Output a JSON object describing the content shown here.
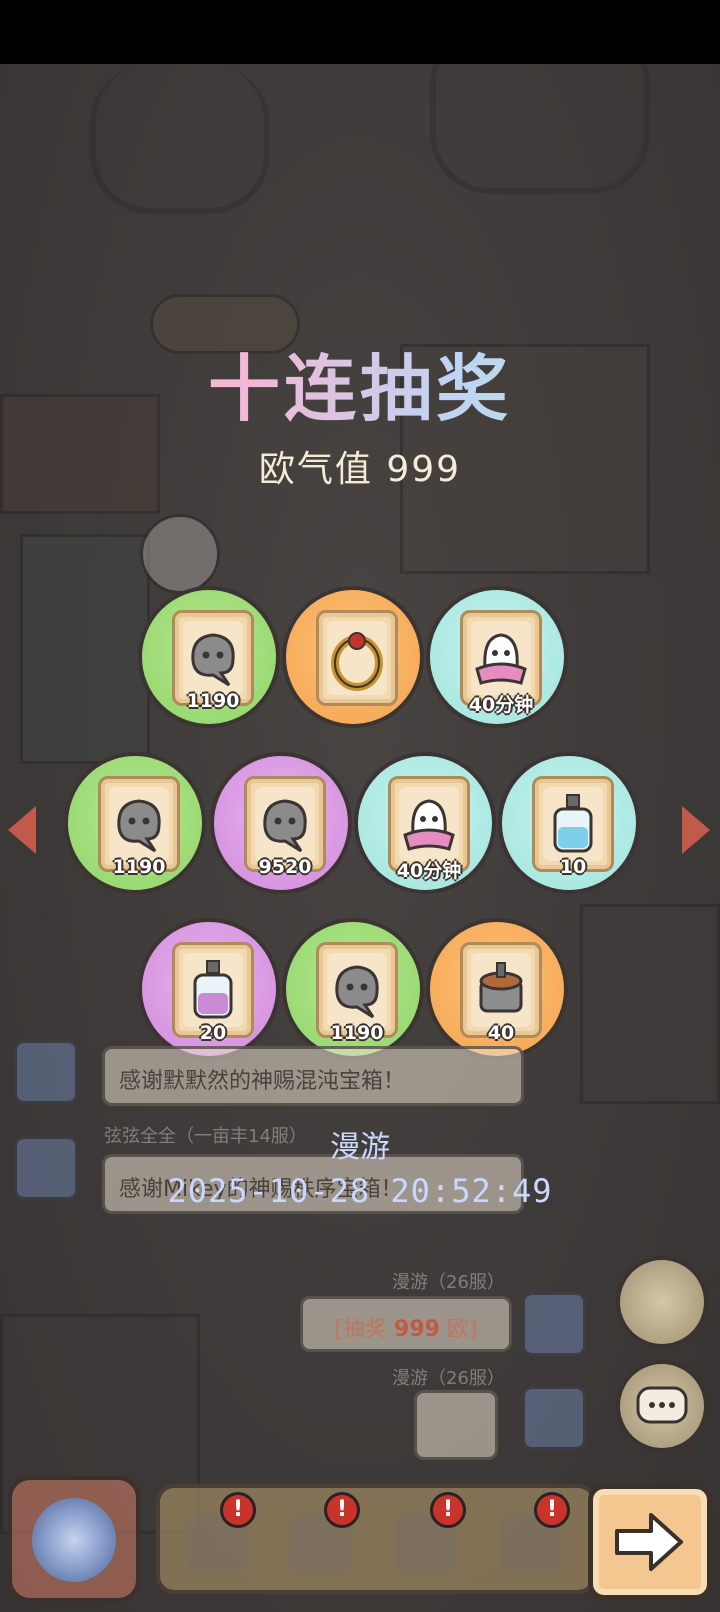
{
  "title": "十连抽奖",
  "luck_label": "欧气值 999",
  "rewards": [
    {
      "amount": "1190",
      "item": "ghost-spirit-icon",
      "color": "green"
    },
    {
      "amount": "",
      "item": "ring-icon",
      "color": "orange"
    },
    {
      "amount": "40分钟",
      "item": "ghost-blanket-icon",
      "color": "cyan"
    },
    {
      "amount": "1190",
      "item": "ghost-spirit-icon",
      "color": "green"
    },
    {
      "amount": "9520",
      "item": "ghost-spirit-icon",
      "color": "purple"
    },
    {
      "amount": "40分钟",
      "item": "ghost-blanket-icon",
      "color": "cyan"
    },
    {
      "amount": "10",
      "item": "potion-bottle-icon",
      "color": "cyan"
    },
    {
      "amount": "20",
      "item": "potion-bottle-icon",
      "color": "purple"
    },
    {
      "amount": "1190",
      "item": "ghost-spirit-icon",
      "color": "green"
    },
    {
      "amount": "40",
      "item": "machine-part-icon",
      "color": "orange"
    }
  ],
  "chat": {
    "msg1": "感谢默默然的神赐混沌宝箱！",
    "user2": "弦弦全全（一亩丰14服）",
    "msg2": "感谢Mikey的神赐秩序宝箱！",
    "user3": "漫游（26服）",
    "lottery_prefix": "[抽奖 ",
    "lottery_value": "999",
    "lottery_suffix": " 欧]",
    "user4": "漫游（26服）"
  },
  "watermark": {
    "name": "漫游",
    "time": "2025-10-28 20:52:49"
  },
  "colors": {
    "green": "#9bdc74",
    "orange": "#f6ad5a",
    "cyan": "#aee9e3",
    "purple": "#d99be3",
    "badge": "#c8332c"
  },
  "nav": [
    "portal-icon",
    "chick-icon",
    "backpack-icon",
    "bust-statue-icon",
    "pyramid-eye-icon",
    "next-arrow-icon"
  ]
}
